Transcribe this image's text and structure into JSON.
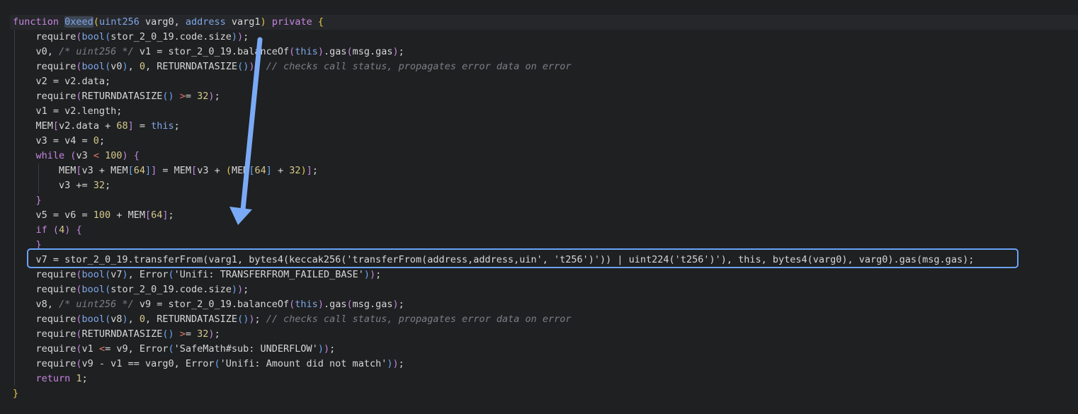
{
  "code_lines": [
    "function 0xeed(uint256 varg0, address varg1) private {",
    "    require(bool(stor_2_0_19.code.size));",
    "    v0, /* uint256 */ v1 = stor_2_0_19.balanceOf(this).gas(msg.gas);",
    "    require(bool(v0), 0, RETURNDATASIZE()); // checks call status, propagates error data on error",
    "    v2 = v2.data;",
    "    require(RETURNDATASIZE() >= 32);",
    "    v1 = v2.length;",
    "    MEM[v2.data + 68] = this;",
    "    v3 = v4 = 0;",
    "    while (v3 < 100) {",
    "        MEM[v3 + MEM[64]] = MEM[v3 + (MEM[64] + 32)];",
    "        v3 += 32;",
    "    }",
    "    v5 = v6 = 100 + MEM[64];",
    "    if (4) {",
    "    }",
    "    v7 = stor_2_0_19.transferFrom(varg1, bytes4(keccak256('transferFrom(address,address,uin', 't256')')) | uint224('t256')'), this, bytes4(varg0), varg0).gas(msg.gas);",
    "    require(bool(v7), Error('Unifi: TRANSFERFROM_FAILED_BASE'));",
    "    require(bool(stor_2_0_19.code.size));",
    "    v8, /* uint256 */ v9 = stor_2_0_19.balanceOf(this).gas(msg.gas);",
    "    require(bool(v8), 0, RETURNDATASIZE()); // checks call status, propagates error data on error",
    "    require(RETURNDATASIZE() >= 32);",
    "    require(v1 <= v9, Error('SafeMath#sub: UNDERFLOW'));",
    "    require(v9 - v1 == varg0, Error('Unifi: Amount did not match'));",
    "    return 1;",
    "}"
  ],
  "colors": {
    "background": "#1f2022",
    "keyword": "#c586e0",
    "type": "#7fa6e8",
    "number": "#d6c98a",
    "comment": "#7b7f86",
    "highlight_box": "#6aa3f8",
    "arrow": "#7aaaf5"
  },
  "annotations": {
    "arrow": "arrow-down-icon",
    "box": "highlight-box"
  }
}
